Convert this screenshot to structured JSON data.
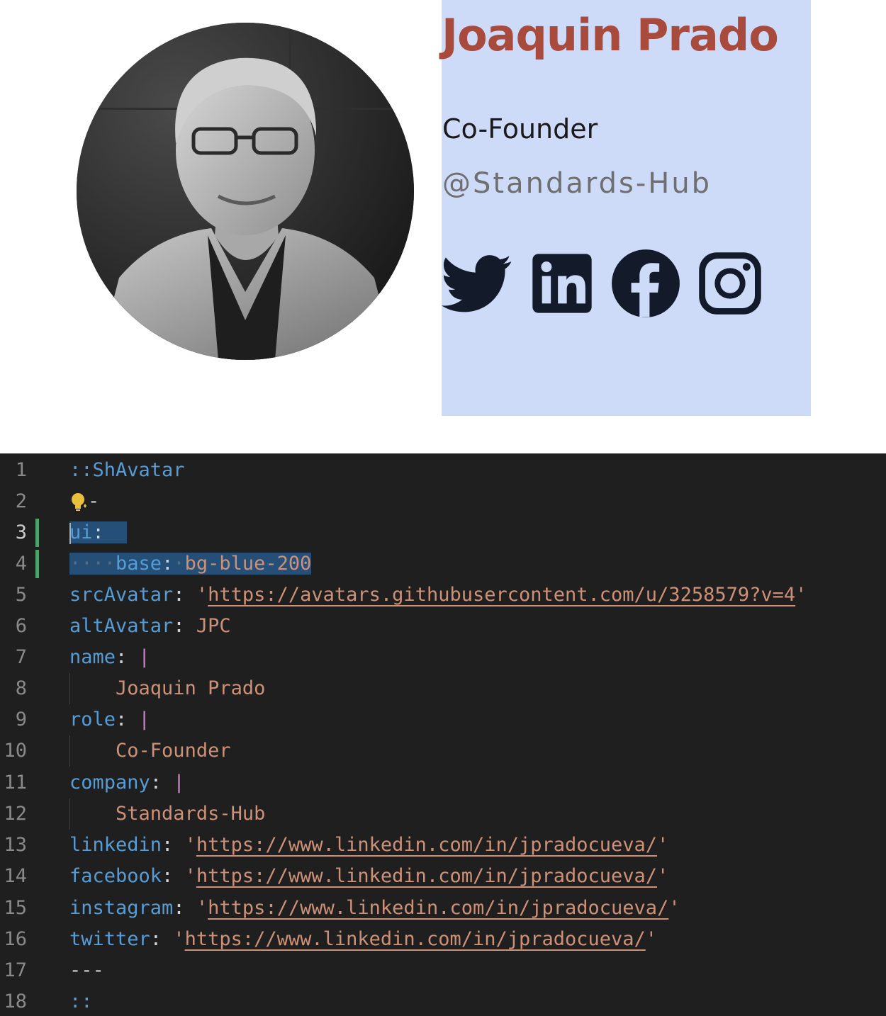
{
  "profile": {
    "name": "Joaquin Prado",
    "role": "Co-Founder",
    "company": "@Standards-Hub",
    "avatar_alt": "JPC",
    "colors": {
      "card_bg": "#cddaf8",
      "name": "#a84a3c",
      "role": "#1a1a1a",
      "company": "#6f6f70",
      "icons": "#131a29"
    },
    "social": [
      {
        "network": "twitter",
        "icon": "twitter-icon"
      },
      {
        "network": "linkedin",
        "icon": "linkedin-icon"
      },
      {
        "network": "facebook",
        "icon": "facebook-icon"
      },
      {
        "network": "instagram",
        "icon": "instagram-icon"
      }
    ]
  },
  "editor": {
    "line_numbers": [
      "1",
      "2",
      "3",
      "4",
      "5",
      "6",
      "7",
      "8",
      "9",
      "10",
      "11",
      "12",
      "13",
      "14",
      "15",
      "16",
      "17",
      "18"
    ],
    "active_line": "3",
    "lines": {
      "l1": "::ShAvatar",
      "l2": "-",
      "l3_key": "ui",
      "l4_key": "base",
      "l4_val": "bg-blue-200",
      "l5_key": "srcAvatar",
      "l5_url": "https://avatars.githubusercontent.com/u/3258579?v=4",
      "l6_key": "altAvatar",
      "l6_val": "JPC",
      "l7_key": "name",
      "l8_val": "Joaquin Prado",
      "l9_key": "role",
      "l10_val": "Co-Founder",
      "l11_key": "company",
      "l12_val": "Standards-Hub",
      "l13_key": "linkedin",
      "l13_url": "https://www.linkedin.com/in/jpradocueva/",
      "l14_key": "facebook",
      "l14_url": "https://www.linkedin.com/in/jpradocueva/",
      "l15_key": "instagram",
      "l15_url": "https://www.linkedin.com/in/jpradocueva/",
      "l16_key": "twitter",
      "l16_url": "https://www.linkedin.com/in/jpradocueva/",
      "l17": "---",
      "l18": "::"
    },
    "colors": {
      "bg": "#1f1f1f",
      "key": "#569cd6",
      "string": "#ce9178",
      "selection": "#264f78",
      "modified": "#4fa36a"
    }
  }
}
